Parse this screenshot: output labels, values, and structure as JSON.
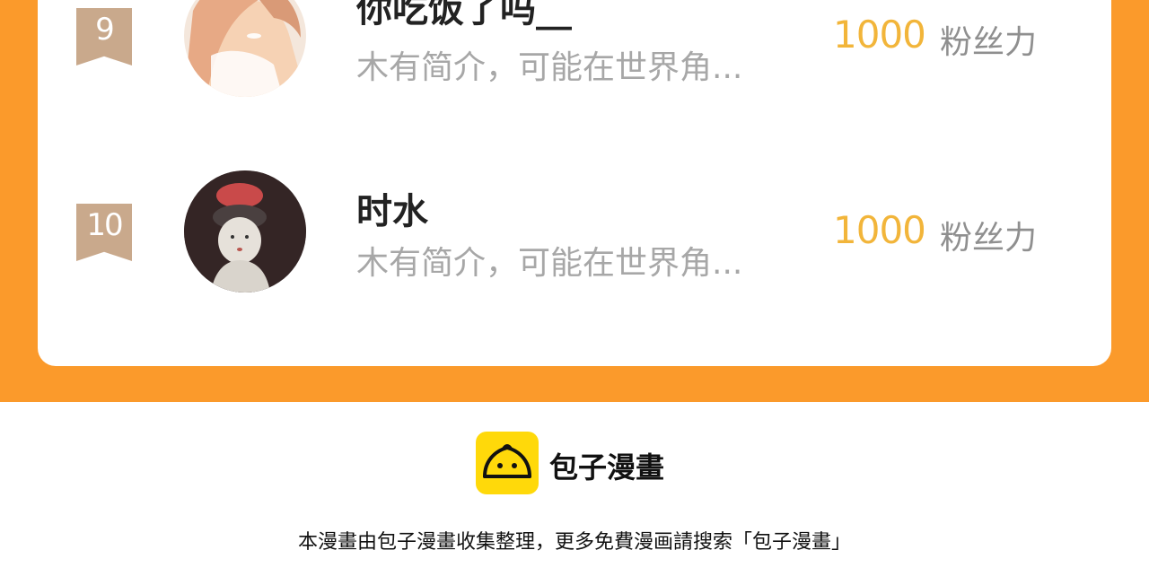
{
  "ranking": [
    {
      "rank": "9",
      "name": "你吃饭了吗__",
      "bio": "木有简介，可能在世界角...",
      "fans_value": "1000",
      "fans_label": "粉丝力"
    },
    {
      "rank": "10",
      "name": "时水",
      "bio": "木有简介，可能在世界角...",
      "fans_value": "1000",
      "fans_label": "粉丝力"
    }
  ],
  "footer": {
    "brand": "包子漫畫",
    "note": "本漫畫由包子漫畫收集整理，更多免費漫画請搜索「包子漫畫」"
  },
  "colors": {
    "orange_band": "#fb9a2b",
    "rank_badge": "#c9a98c",
    "fans_value": "#f2b53a",
    "logo_yellow": "#ffd90a"
  }
}
